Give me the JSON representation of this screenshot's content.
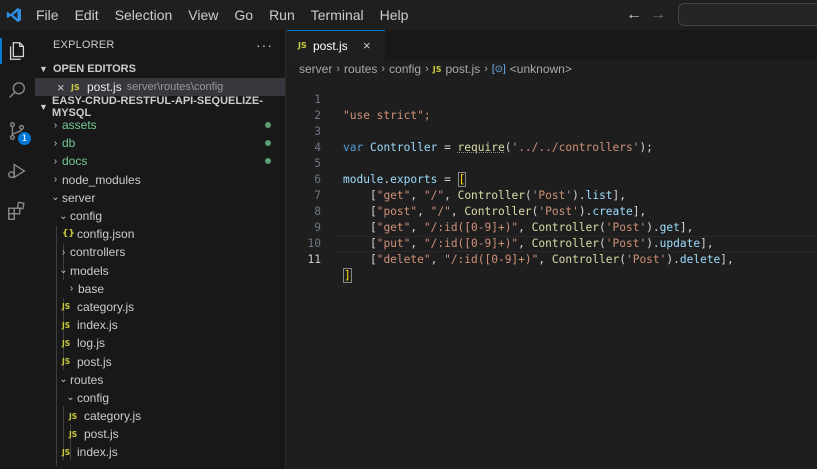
{
  "menu": [
    "File",
    "Edit",
    "Selection",
    "View",
    "Go",
    "Run",
    "Terminal",
    "Help"
  ],
  "nav": {
    "back": "←",
    "forward": "→"
  },
  "activity": {
    "scm_badge": "1"
  },
  "sidebar": {
    "title": "EXPLORER",
    "more": "···",
    "open_editors_label": "OPEN EDITORS",
    "open_editor": {
      "close": "×",
      "icon": "JS",
      "name": "post.js",
      "path": "server\\routes\\config"
    },
    "project_label": "EASY-CRUD-RESTFUL-API-SEQUELIZE-MYSQL",
    "tree": [
      {
        "label": "assets",
        "chev": "›",
        "git": true
      },
      {
        "label": "db",
        "chev": "›",
        "git": true
      },
      {
        "label": "docs",
        "chev": "›",
        "git": true
      },
      {
        "label": "node_modules",
        "chev": "›"
      },
      {
        "label": "server",
        "chev": "⌄"
      },
      {
        "label": "config",
        "chev": "⌄"
      },
      {
        "label": "config.json",
        "icon": "{}"
      },
      {
        "label": "controllers",
        "chev": "›"
      },
      {
        "label": "models",
        "chev": "⌄"
      },
      {
        "label": "base",
        "chev": "›"
      },
      {
        "label": "category.js",
        "icon": "JS"
      },
      {
        "label": "index.js",
        "icon": "JS"
      },
      {
        "label": "log.js",
        "icon": "JS"
      },
      {
        "label": "post.js",
        "icon": "JS"
      },
      {
        "label": "routes",
        "chev": "⌄"
      },
      {
        "label": "config",
        "chev": "⌄"
      },
      {
        "label": "category.js",
        "icon": "JS"
      },
      {
        "label": "post.js",
        "icon": "JS"
      },
      {
        "label": "index.js",
        "icon": "JS"
      }
    ]
  },
  "editor": {
    "tab": {
      "icon": "JS",
      "name": "post.js",
      "close": "×"
    },
    "breadcrumbs": [
      "server",
      "routes",
      "config",
      "post.js",
      "<unknown>"
    ],
    "breadcrumb_icon": "JS",
    "line_numbers": [
      "1",
      "2",
      "3",
      "4",
      "5",
      "6",
      "7",
      "8",
      "9",
      "10",
      "11"
    ],
    "code": {
      "l1": "\"use strict\";",
      "l3": {
        "var": "var",
        "name": "Controller",
        "eq": " = ",
        "fn": "require",
        "open": "(",
        "arg": "'../../controllers'",
        "close": ");"
      },
      "l5": {
        "obj": "module",
        "dot": ".",
        "prop": "exports",
        "eq": " = ",
        "bracket": "["
      },
      "routes": [
        {
          "method": "\"get\"",
          "path": "\"/\"",
          "ctrl": "Controller",
          "arg": "'Post'",
          "action": "list"
        },
        {
          "method": "\"post\"",
          "path": "\"/\"",
          "ctrl": "Controller",
          "arg": "'Post'",
          "action": "create"
        },
        {
          "method": "\"get\"",
          "path": "\"/:id([0-9]+)\"",
          "ctrl": "Controller",
          "arg": "'Post'",
          "action": "get"
        },
        {
          "method": "\"put\"",
          "path": "\"/:id([0-9]+)\"",
          "ctrl": "Controller",
          "arg": "'Post'",
          "action": "update"
        },
        {
          "method": "\"delete\"",
          "path": "\"/:id([0-9]+)\"",
          "ctrl": "Controller",
          "arg": "'Post'",
          "action": "delete"
        }
      ],
      "l11": "]"
    }
  }
}
